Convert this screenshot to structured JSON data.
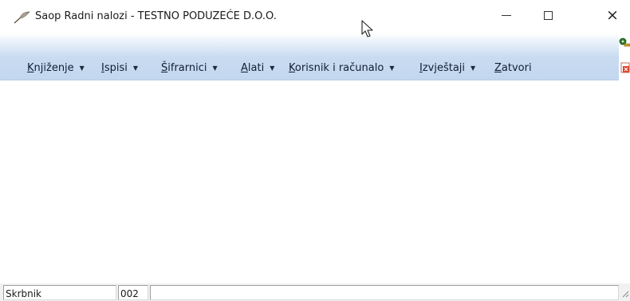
{
  "window": {
    "title": "Saop Radni nalozi - TESTNO PODUZEĆE D.O.O.",
    "app_icon": "feather-pen-icon",
    "controls": {
      "minimize": "minimize-icon",
      "maximize": "maximize-icon",
      "close": "×"
    }
  },
  "menu": {
    "items": [
      {
        "label": "Knjiženje",
        "has_dropdown": true
      },
      {
        "label": "Ispisi",
        "has_dropdown": true
      },
      {
        "label": "Šifrarnici",
        "has_dropdown": true
      },
      {
        "label": "Alati",
        "has_dropdown": true
      },
      {
        "label": "Korisnik i računalo",
        "has_dropdown": true
      },
      {
        "label": "Izvještaji",
        "has_dropdown": true
      },
      {
        "label": "Zatvori",
        "has_dropdown": false
      }
    ],
    "dropdown_glyph": "▼",
    "side_icons": [
      "key-icon",
      "close-document-icon"
    ]
  },
  "status": {
    "user": "Skrbnik",
    "code": "002",
    "message": ""
  },
  "colors": {
    "menubar_gradient_end": "#c3d7ef",
    "title_text": "#1a1a1a"
  }
}
